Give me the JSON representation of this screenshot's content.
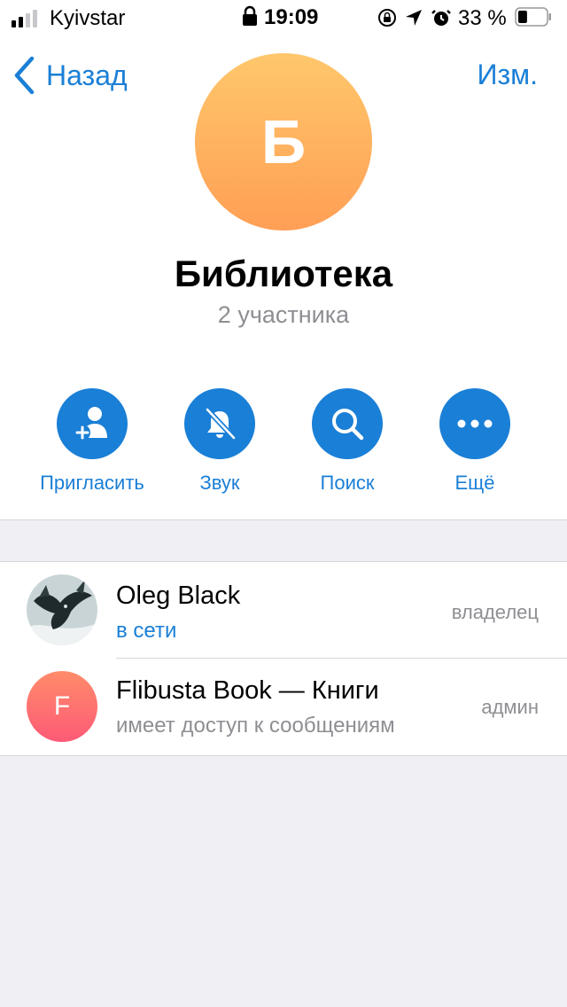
{
  "status_bar": {
    "carrier": "Kyivstar",
    "time": "19:09",
    "battery_percent": "33 %",
    "battery_level": 0.33
  },
  "nav": {
    "back_label": "Назад",
    "edit_label": "Изм."
  },
  "group": {
    "avatar_letter": "Б",
    "title": "Библиотека",
    "subtitle": "2 участника"
  },
  "actions": [
    {
      "label": "Пригласить",
      "icon": "add-user-icon"
    },
    {
      "label": "Звук",
      "icon": "bell-muted-icon"
    },
    {
      "label": "Поиск",
      "icon": "search-icon"
    },
    {
      "label": "Ещё",
      "icon": "more-icon"
    }
  ],
  "members": [
    {
      "name": "Oleg Black",
      "status": "в сети",
      "role": "владелец",
      "status_color": "#1a7fd6"
    },
    {
      "name": "Flibusta Book — Книги",
      "status": "имеет доступ к сообщениям",
      "role": "админ",
      "avatar_letter": "F",
      "status_color": "#8e8e93"
    }
  ],
  "colors": {
    "accent": "#1a7fd6",
    "avatar_gradient_top": "#ffc76b",
    "avatar_gradient_bottom": "#ff9f55"
  }
}
